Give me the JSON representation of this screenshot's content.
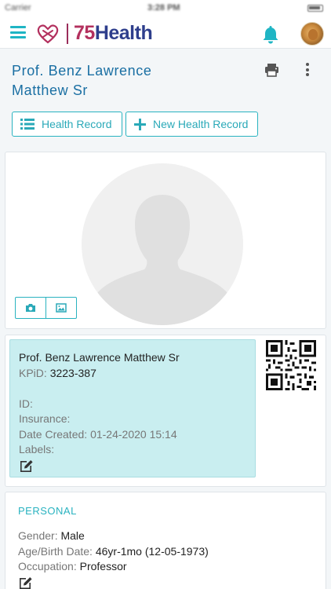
{
  "status_bar": {
    "carrier": "Carrier",
    "time": "3:28 PM"
  },
  "app_bar": {
    "logo_number": "75",
    "logo_word": "Health",
    "menu_icon": "hamburger-icon",
    "notification_icon": "bell-icon",
    "accent_color": "#1fb5c4",
    "brand_color": "#2e3e8c",
    "brand_accent_color": "#b3305e"
  },
  "patient": {
    "title_line1": "Prof. Benz Lawrence",
    "title_line2": "Matthew Sr"
  },
  "actions": {
    "health_record_label": "Health Record",
    "new_health_record_label": "New Health Record"
  },
  "info_card": {
    "full_name": "Prof. Benz Lawrence Matthew Sr",
    "kpid_label": "KPiD:",
    "kpid_value": "3223-387",
    "id_label": "ID:",
    "id_value": "",
    "insurance_label": "Insurance:",
    "insurance_value": "",
    "date_created_label": "Date Created:",
    "date_created_value": "01-24-2020 15:14",
    "labels_label": "Labels:",
    "labels_value": "",
    "box_color": "#c9eef0"
  },
  "personal": {
    "section_title": "PERSONAL",
    "gender_label": "Gender:",
    "gender_value": "Male",
    "age_label": "Age/Birth Date:",
    "age_value": "46yr-1mo (12-05-1973)",
    "occupation_label": "Occupation:",
    "occupation_value": "Professor"
  }
}
